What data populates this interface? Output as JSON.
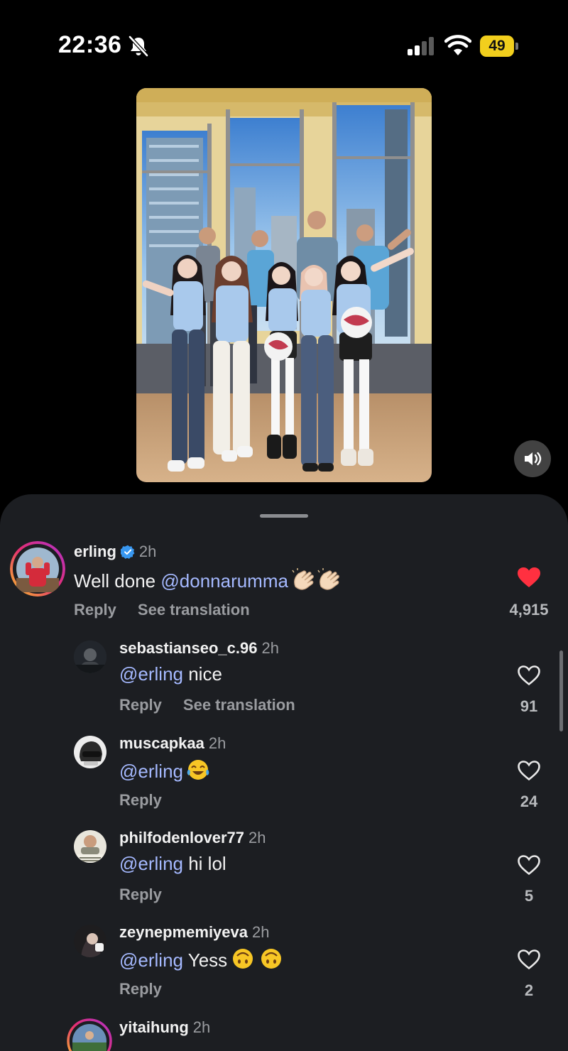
{
  "status_bar": {
    "time": "22:36",
    "battery": "49",
    "icons": [
      "bell-slash-icon",
      "cellular-signal-icon",
      "wifi-icon",
      "battery-icon"
    ],
    "battery_color": "#f2cf1d"
  },
  "video": {
    "volume_icon": "speaker-icon"
  },
  "comments": [
    {
      "username": "erling",
      "verified": true,
      "time": "2h",
      "mention": "@donnarumma",
      "text_before": "Well done ",
      "text_after": "",
      "emojis": "👏🏻 👏🏻",
      "reply_label": "Reply",
      "translate_label": "See translation",
      "liked": true,
      "like_count": "4,915"
    },
    {
      "username": "sebastianseo_c.96",
      "time": "2h",
      "mention": "@erling",
      "text_after": " nice",
      "reply_label": "Reply",
      "translate_label": "See translation",
      "liked": false,
      "like_count": "91"
    },
    {
      "username": "muscapkaa",
      "time": "2h",
      "mention": "@erling",
      "text_after": "",
      "emojis": "😂",
      "reply_label": "Reply",
      "liked": false,
      "like_count": "24"
    },
    {
      "username": "philfodenlover77",
      "time": "2h",
      "mention": "@erling",
      "text_after": " hi lol",
      "reply_label": "Reply",
      "liked": false,
      "like_count": "5"
    },
    {
      "username": "zeynepmemiyeva",
      "time": "2h",
      "mention": "@erling",
      "text_after": " Yess",
      "emojis": "🙃 🙃",
      "reply_label": "Reply",
      "liked": false,
      "like_count": "2"
    },
    {
      "username": "yitaihung",
      "time": "2h"
    }
  ],
  "colors": {
    "sheet_background": "#1c1e22",
    "mention": "#a5b9ff",
    "liked_heart": "#ff3040"
  }
}
